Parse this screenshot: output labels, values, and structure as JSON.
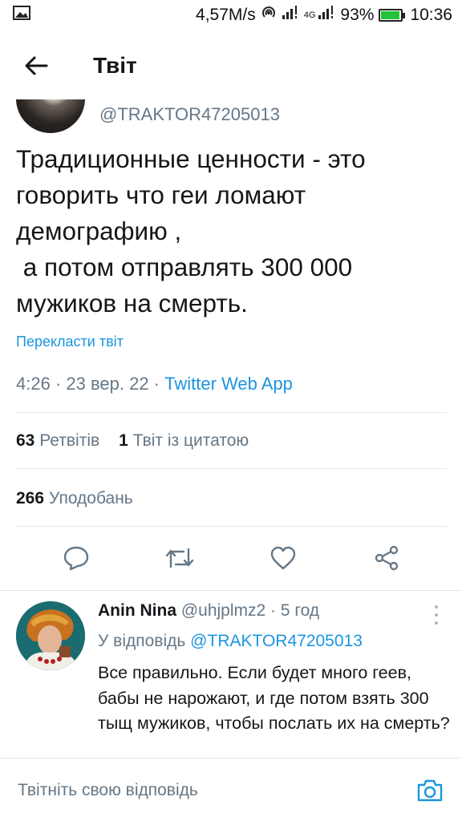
{
  "status_bar": {
    "speed": "4,57M/s",
    "network": "4G",
    "battery": "93%",
    "battery_level": 0.93,
    "time": "10:36"
  },
  "header": {
    "title": "Твіт"
  },
  "tweet": {
    "handle": "@TRAKTOR47205013",
    "text": "Традиционные ценности - это\nговорить что геи ломают\nдемографию ,\n а потом отправлять 300 000\nмужиков на смерть.",
    "translate": "Перекласти твіт",
    "time": "4:26 · 23 вер. 22 · ",
    "source": "Twitter Web App",
    "retweets_count": "63",
    "retweets_label": "Ретвітів",
    "quotes_count": "1",
    "quotes_label": "Твіт із цитатою",
    "likes_count": "266",
    "likes_label": "Уподобань"
  },
  "reply": {
    "name": "Anin Nina",
    "handle": "@uhjplmz2",
    "time": "· 5 год",
    "replying_label": "У відповідь",
    "replying_to": "@TRAKTOR47205013",
    "text": "Все правильно. Если будет много геев, бабы не нарожают, и где потом взять 300 тыщ мужиков, чтобы послать их на смерть?"
  },
  "compose": {
    "placeholder": "Твітніть свою відповідь"
  },
  "colors": {
    "accent": "#1b95e0",
    "secondary": "#657786",
    "divider": "#e1e8ed"
  },
  "icons": [
    "image-icon",
    "hotspot-icon",
    "signal-icon",
    "battery-icon",
    "back-arrow-icon",
    "reply-icon",
    "retweet-icon",
    "like-icon",
    "share-icon",
    "more-icon",
    "camera-icon"
  ]
}
